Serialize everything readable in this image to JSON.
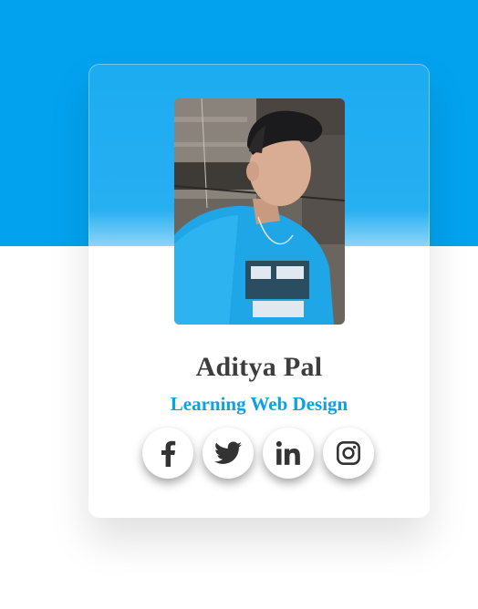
{
  "colors": {
    "accent": "#03a2ef",
    "name_text": "#3d3d3d",
    "role_text": "#0ba0e8",
    "icon": "#333333"
  },
  "profile": {
    "photo_icon": "profile-photo",
    "name": "Aditya Pal",
    "role": "Learning Web Design"
  },
  "socials": [
    {
      "icon": "facebook-icon"
    },
    {
      "icon": "twitter-icon"
    },
    {
      "icon": "linkedin-icon"
    },
    {
      "icon": "instagram-icon"
    }
  ]
}
